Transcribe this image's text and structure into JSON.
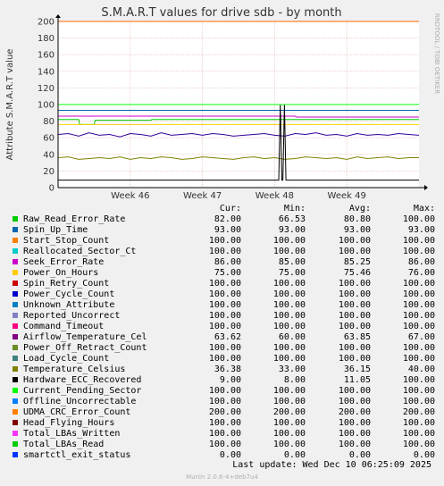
{
  "chart_data": {
    "type": "line",
    "title": "S.M.A.R.T values for drive sdb - by month",
    "ylabel": "Attribute S.M.A.R.T value",
    "side_label": "RRDTOOL / TOBI OETIKER",
    "ylim": [
      0,
      200
    ],
    "yticks": [
      "0",
      "20",
      "40",
      "60",
      "80",
      "100",
      "120",
      "140",
      "160",
      "180",
      "200"
    ],
    "xlim": [
      0,
      35
    ],
    "xticks": [
      {
        "label": "Week 46",
        "x": 7
      },
      {
        "label": "Week 47",
        "x": 14
      },
      {
        "label": "Week 48",
        "x": 21
      },
      {
        "label": "Week 49",
        "x": 28
      }
    ],
    "grid": true,
    "series": [
      {
        "name": "Raw_Read_Error_Rate",
        "color": "#00cc00",
        "x": [
          0,
          2,
          2.1,
          3.5,
          3.6,
          9,
          9.1,
          24,
          24.1,
          35
        ],
        "y": [
          82,
          82,
          76,
          76,
          81,
          81,
          82,
          82,
          82,
          82
        ]
      },
      {
        "name": "Spin_Up_Time",
        "color": "#0066b3",
        "x": [
          0,
          35
        ],
        "y": [
          93,
          93
        ]
      },
      {
        "name": "Start_Stop_Count",
        "color": "#ff8000",
        "x": [
          0,
          35
        ],
        "y": [
          100,
          100
        ]
      },
      {
        "name": "Reallocated_Sector_Ct",
        "color": "#00cccc",
        "x": [
          0,
          35
        ],
        "y": [
          100,
          100
        ]
      },
      {
        "name": "Seek_Error_Rate",
        "color": "#cc00cc",
        "x": [
          0,
          23,
          23.1,
          35
        ],
        "y": [
          86,
          86,
          85,
          85
        ]
      },
      {
        "name": "Power_On_Hours",
        "color": "#ffcc00",
        "x": [
          0,
          35
        ],
        "y": [
          76,
          76
        ]
      },
      {
        "name": "Airflow_Temperature_Cel",
        "color": "#330099",
        "x": [
          0,
          1,
          2,
          3,
          4,
          5,
          6,
          7,
          8,
          9,
          10,
          11,
          12,
          13,
          14,
          15,
          16,
          17,
          18,
          19,
          20,
          21,
          22,
          23,
          24,
          25,
          26,
          27,
          28,
          29,
          30,
          31,
          32,
          33,
          34,
          35
        ],
        "y": [
          64,
          65,
          62,
          66,
          63,
          64,
          61,
          65,
          64,
          62,
          66,
          63,
          64,
          65,
          63,
          65,
          64,
          62,
          63,
          64,
          65,
          63,
          62,
          65,
          64,
          66,
          63,
          64,
          62,
          65,
          63,
          64,
          63,
          65,
          64,
          63
        ]
      },
      {
        "name": "Temperature_Celsius",
        "color": "#808000",
        "x": [
          0,
          1,
          2,
          3,
          4,
          5,
          6,
          7,
          8,
          9,
          10,
          11,
          12,
          13,
          14,
          15,
          16,
          17,
          18,
          19,
          20,
          21,
          22,
          23,
          24,
          25,
          26,
          27,
          28,
          29,
          30,
          31,
          32,
          33,
          34,
          35
        ],
        "y": [
          36,
          37,
          34,
          35,
          36,
          35,
          37,
          34,
          36,
          35,
          37,
          36,
          34,
          35,
          37,
          36,
          35,
          34,
          36,
          37,
          35,
          36,
          34,
          35,
          37,
          36,
          35,
          36,
          34,
          37,
          35,
          36,
          37,
          35,
          36,
          36
        ]
      },
      {
        "name": "Hardware_ECC_Recovered",
        "color": "#000000",
        "x": [
          0,
          21.4,
          21.55,
          21.7,
          21.8,
          21.95,
          22.1,
          35
        ],
        "y": [
          9,
          9,
          100,
          9,
          9,
          100,
          9,
          9
        ]
      },
      {
        "name": "Current_Pending_Sector",
        "color": "#00ff00",
        "x": [
          0,
          35
        ],
        "y": [
          100,
          100
        ]
      },
      {
        "name": "UDMA_CRC_Error_Count",
        "color": "#ff6600",
        "x": [
          0,
          35
        ],
        "y": [
          200,
          200
        ]
      },
      {
        "name": "smartctl_exit_status",
        "color": "#0033ff",
        "x": [
          0,
          35
        ],
        "y": [
          0,
          0
        ]
      }
    ]
  },
  "legend": {
    "headers": {
      "cur": "Cur:",
      "min": "Min:",
      "avg": "Avg:",
      "max": "Max:"
    },
    "rows": [
      {
        "name": "Raw_Read_Error_Rate",
        "color": "#00cc00",
        "cur": "82.00",
        "min": "66.53",
        "avg": "80.80",
        "max": "100.00"
      },
      {
        "name": "Spin_Up_Time",
        "color": "#0066b3",
        "cur": "93.00",
        "min": "93.00",
        "avg": "93.00",
        "max": "93.00"
      },
      {
        "name": "Start_Stop_Count",
        "color": "#ff8000",
        "cur": "100.00",
        "min": "100.00",
        "avg": "100.00",
        "max": "100.00"
      },
      {
        "name": "Reallocated_Sector_Ct",
        "color": "#00cccc",
        "cur": "100.00",
        "min": "100.00",
        "avg": "100.00",
        "max": "100.00"
      },
      {
        "name": "Seek_Error_Rate",
        "color": "#cc00cc",
        "cur": "86.00",
        "min": "85.00",
        "avg": "85.25",
        "max": "86.00"
      },
      {
        "name": "Power_On_Hours",
        "color": "#ffcc00",
        "cur": "75.00",
        "min": "75.00",
        "avg": "75.46",
        "max": "76.00"
      },
      {
        "name": "Spin_Retry_Count",
        "color": "#cc0000",
        "cur": "100.00",
        "min": "100.00",
        "avg": "100.00",
        "max": "100.00"
      },
      {
        "name": "Power_Cycle_Count",
        "color": "#0000cc",
        "cur": "100.00",
        "min": "100.00",
        "avg": "100.00",
        "max": "100.00"
      },
      {
        "name": "Unknown_Attribute",
        "color": "#0080c0",
        "cur": "100.00",
        "min": "100.00",
        "avg": "100.00",
        "max": "100.00"
      },
      {
        "name": "Reported_Uncorrect",
        "color": "#8080c0",
        "cur": "100.00",
        "min": "100.00",
        "avg": "100.00",
        "max": "100.00"
      },
      {
        "name": "Command_Timeout",
        "color": "#ff0080",
        "cur": "100.00",
        "min": "100.00",
        "avg": "100.00",
        "max": "100.00"
      },
      {
        "name": "Airflow_Temperature_Cel",
        "color": "#800080",
        "cur": "63.62",
        "min": "60.00",
        "avg": "63.85",
        "max": "67.00"
      },
      {
        "name": "Power_Off_Retract_Count",
        "color": "#688e23",
        "cur": "100.00",
        "min": "100.00",
        "avg": "100.00",
        "max": "100.00"
      },
      {
        "name": "Load_Cycle_Count",
        "color": "#408080",
        "cur": "100.00",
        "min": "100.00",
        "avg": "100.00",
        "max": "100.00"
      },
      {
        "name": "Temperature_Celsius",
        "color": "#808000",
        "cur": "36.38",
        "min": "33.00",
        "avg": "36.15",
        "max": "40.00"
      },
      {
        "name": "Hardware_ECC_Recovered",
        "color": "#000000",
        "cur": "9.00",
        "min": "8.00",
        "avg": "11.05",
        "max": "100.00"
      },
      {
        "name": "Current_Pending_Sector",
        "color": "#00ff00",
        "cur": "100.00",
        "min": "100.00",
        "avg": "100.00",
        "max": "100.00"
      },
      {
        "name": "Offline_Uncorrectable",
        "color": "#0080ff",
        "cur": "100.00",
        "min": "100.00",
        "avg": "100.00",
        "max": "100.00"
      },
      {
        "name": "UDMA_CRC_Error_Count",
        "color": "#ff8000",
        "cur": "200.00",
        "min": "200.00",
        "avg": "200.00",
        "max": "200.00"
      },
      {
        "name": "Head_Flying_Hours",
        "color": "#800000",
        "cur": "100.00",
        "min": "100.00",
        "avg": "100.00",
        "max": "100.00"
      },
      {
        "name": "Total_LBAs_Written",
        "color": "#fb31fb",
        "cur": "100.00",
        "min": "100.00",
        "avg": "100.00",
        "max": "100.00"
      },
      {
        "name": "Total_LBAs_Read",
        "color": "#00cc00",
        "cur": "100.00",
        "min": "100.00",
        "avg": "100.00",
        "max": "100.00"
      },
      {
        "name": "smartctl_exit_status",
        "color": "#0033ff",
        "cur": "0.00",
        "min": "0.00",
        "avg": "0.00",
        "max": "0.00"
      }
    ]
  },
  "footer": {
    "last_update": "Last update:  Wed Dec 10 06:25:09 2025",
    "version": "Munin 2.0.6-4+deb7u4"
  }
}
